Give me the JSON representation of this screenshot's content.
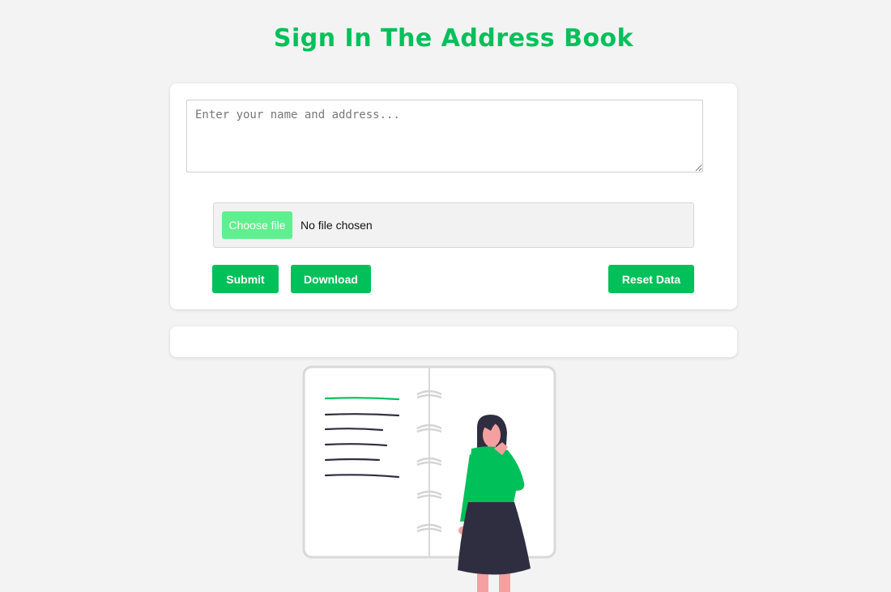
{
  "header": {
    "title": "Sign In The Address Book"
  },
  "form": {
    "entry_placeholder": "Enter your name and address...",
    "entry_value": "",
    "file_button_label": "Choose file",
    "file_status": "No file chosen",
    "submit_label": "Submit",
    "download_label": "Download",
    "reset_label": "Reset Data"
  },
  "entries": [],
  "illustration": {
    "icon": "notebook-woman-illustration"
  },
  "colors": {
    "accent": "#00c05a",
    "accent_light": "#5ef08e",
    "background": "#f3f3f3",
    "ink": "#2f2e41",
    "skin": "#f4a0a0"
  }
}
